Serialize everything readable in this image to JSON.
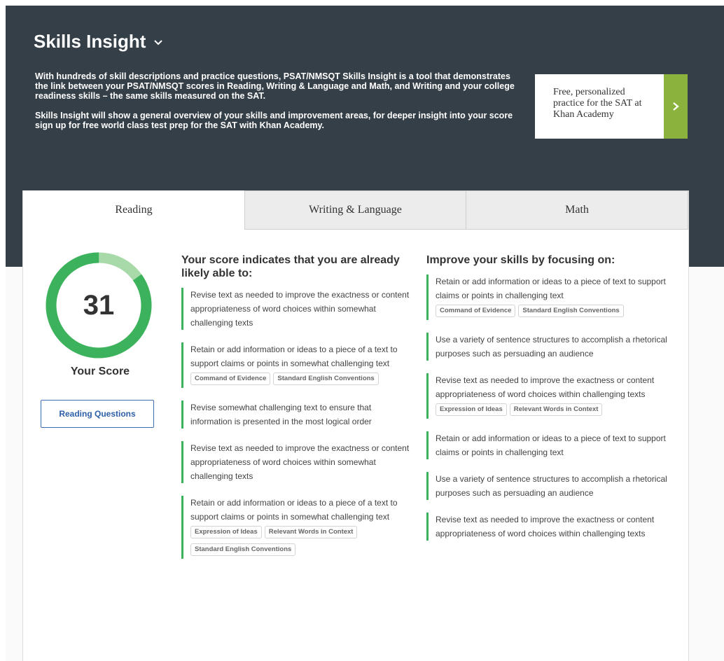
{
  "header": {
    "title": "Skills Insight",
    "description_1": "With hundreds of skill descriptions and practice questions, PSAT/NMSQT Skills Insight is a tool that demonstrates the link between your PSAT/NMSQT scores in Reading, Writing & Language and Math, and Writing and your college readiness skills – the same skills measured on the SAT.",
    "description_2": "Skills Insight will show a general overview of your skills and improvement areas, for deeper insight into your score sign up for free world class test prep for the SAT with Khan Academy.",
    "khan_card_text": "Free, personalized practice for the SAT at Khan Academy"
  },
  "tabs": [
    {
      "label": "Reading"
    },
    {
      "label": "Writing & Language"
    },
    {
      "label": "Math"
    }
  ],
  "score": {
    "value": "31",
    "label": "Your Score",
    "ring_fraction": 0.85,
    "button_label": "Reading Questions"
  },
  "colors": {
    "header_bg": "#353f48",
    "accent_green": "#3db25d",
    "ring_light_green": "#a8d9a9",
    "khan_green": "#8cb23e",
    "link_blue": "#3e6fb5"
  },
  "left_column": {
    "heading": "Your score indicates that you are already likely able to:",
    "items": [
      {
        "text": "Revise text as needed to improve the exactness or content appropriateness of word choices within somewhat challenging texts",
        "tags": []
      },
      {
        "text": "Retain or add information or ideas to a piece of a text to support claims or points in somewhat challenging text",
        "tags": [
          "Command of Evidence",
          "Standard English Conventions"
        ]
      },
      {
        "text": "Revise somewhat challenging text to ensure that information is presented in the most logical order",
        "tags": []
      },
      {
        "text": "Revise text as needed to improve the exactness or content appropriateness of word choices within somewhat challenging texts",
        "tags": []
      },
      {
        "text": "Retain or add information or ideas to a piece of a text to support claims or points in somewhat challenging text",
        "tags": [
          "Expression of Ideas",
          "Relevant Words in Context",
          "Standard English Conventions"
        ]
      }
    ]
  },
  "right_column": {
    "heading": "Improve your skills by focusing on:",
    "items": [
      {
        "text": "Retain or add information or ideas to a piece of text to support claims or points in challenging text",
        "tags": [
          "Command of Evidence",
          "Standard English Conventions"
        ]
      },
      {
        "text": "Use a variety of sentence structures to accomplish a rhetorical purposes such as persuading an audience",
        "tags": []
      },
      {
        "text": "Revise text as needed to improve the exactness or content appropriateness of word choices within challenging texts",
        "tags": [
          "Expression of Ideas",
          "Relevant Words in Context"
        ]
      },
      {
        "text": "Retain or add information or ideas to a piece of text to support claims or points in challenging text",
        "tags": []
      },
      {
        "text": "Use a variety of sentence structures to accomplish a rhetorical purposes such as persuading an audience",
        "tags": []
      },
      {
        "text": "Revise text as needed to improve the exactness or content appropriateness of word choices within challenging texts",
        "tags": []
      }
    ]
  }
}
